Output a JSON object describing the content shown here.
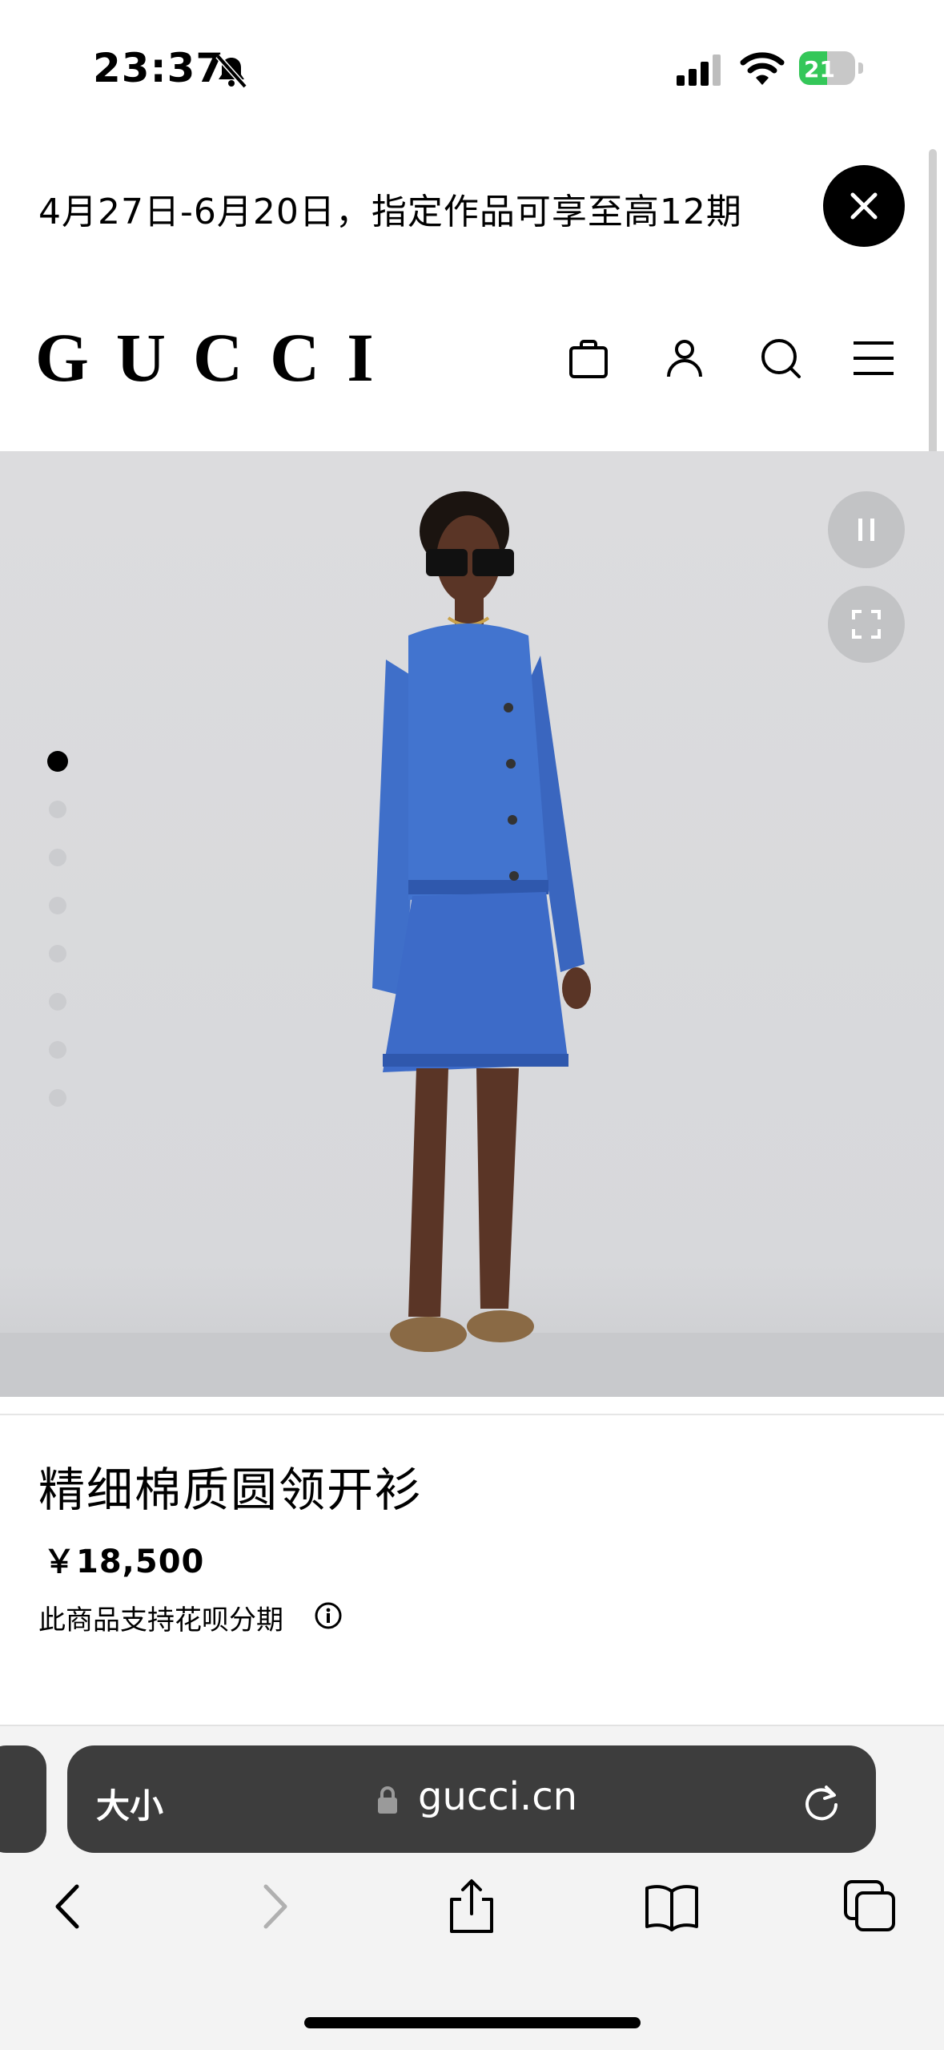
{
  "status_bar": {
    "time": "23:37",
    "battery_level": "21",
    "battery_fraction": 0.21,
    "icons": [
      "bell-slash-icon",
      "cellular-signal-icon",
      "wifi-icon",
      "battery-charging-icon"
    ]
  },
  "promo": {
    "text": "4月27日-6月20日，指定作品可享至高12期",
    "close_icon": "close-icon"
  },
  "header": {
    "logo": "GUCCI",
    "icons": [
      "shopping-bag-icon",
      "account-icon",
      "search-icon",
      "menu-icon"
    ]
  },
  "hero": {
    "controls": [
      "pause-icon",
      "fullscreen-icon"
    ],
    "image_count": 8,
    "active_index": 1,
    "colors": {
      "garment": "#3f6fc9",
      "skin": "#5a3526",
      "shoes": "#8a6a45"
    }
  },
  "product": {
    "name": "精细棉质圆领开衫",
    "price": "￥18,500",
    "installment_note": "此商品支持花呗分期",
    "info_icon": "info-icon"
  },
  "browser": {
    "text_size_label": "大小",
    "url": "gucci.cn",
    "icons": [
      "lock-icon",
      "reload-icon",
      "back-icon",
      "forward-icon",
      "share-icon",
      "bookmarks-icon",
      "tabs-icon"
    ]
  }
}
